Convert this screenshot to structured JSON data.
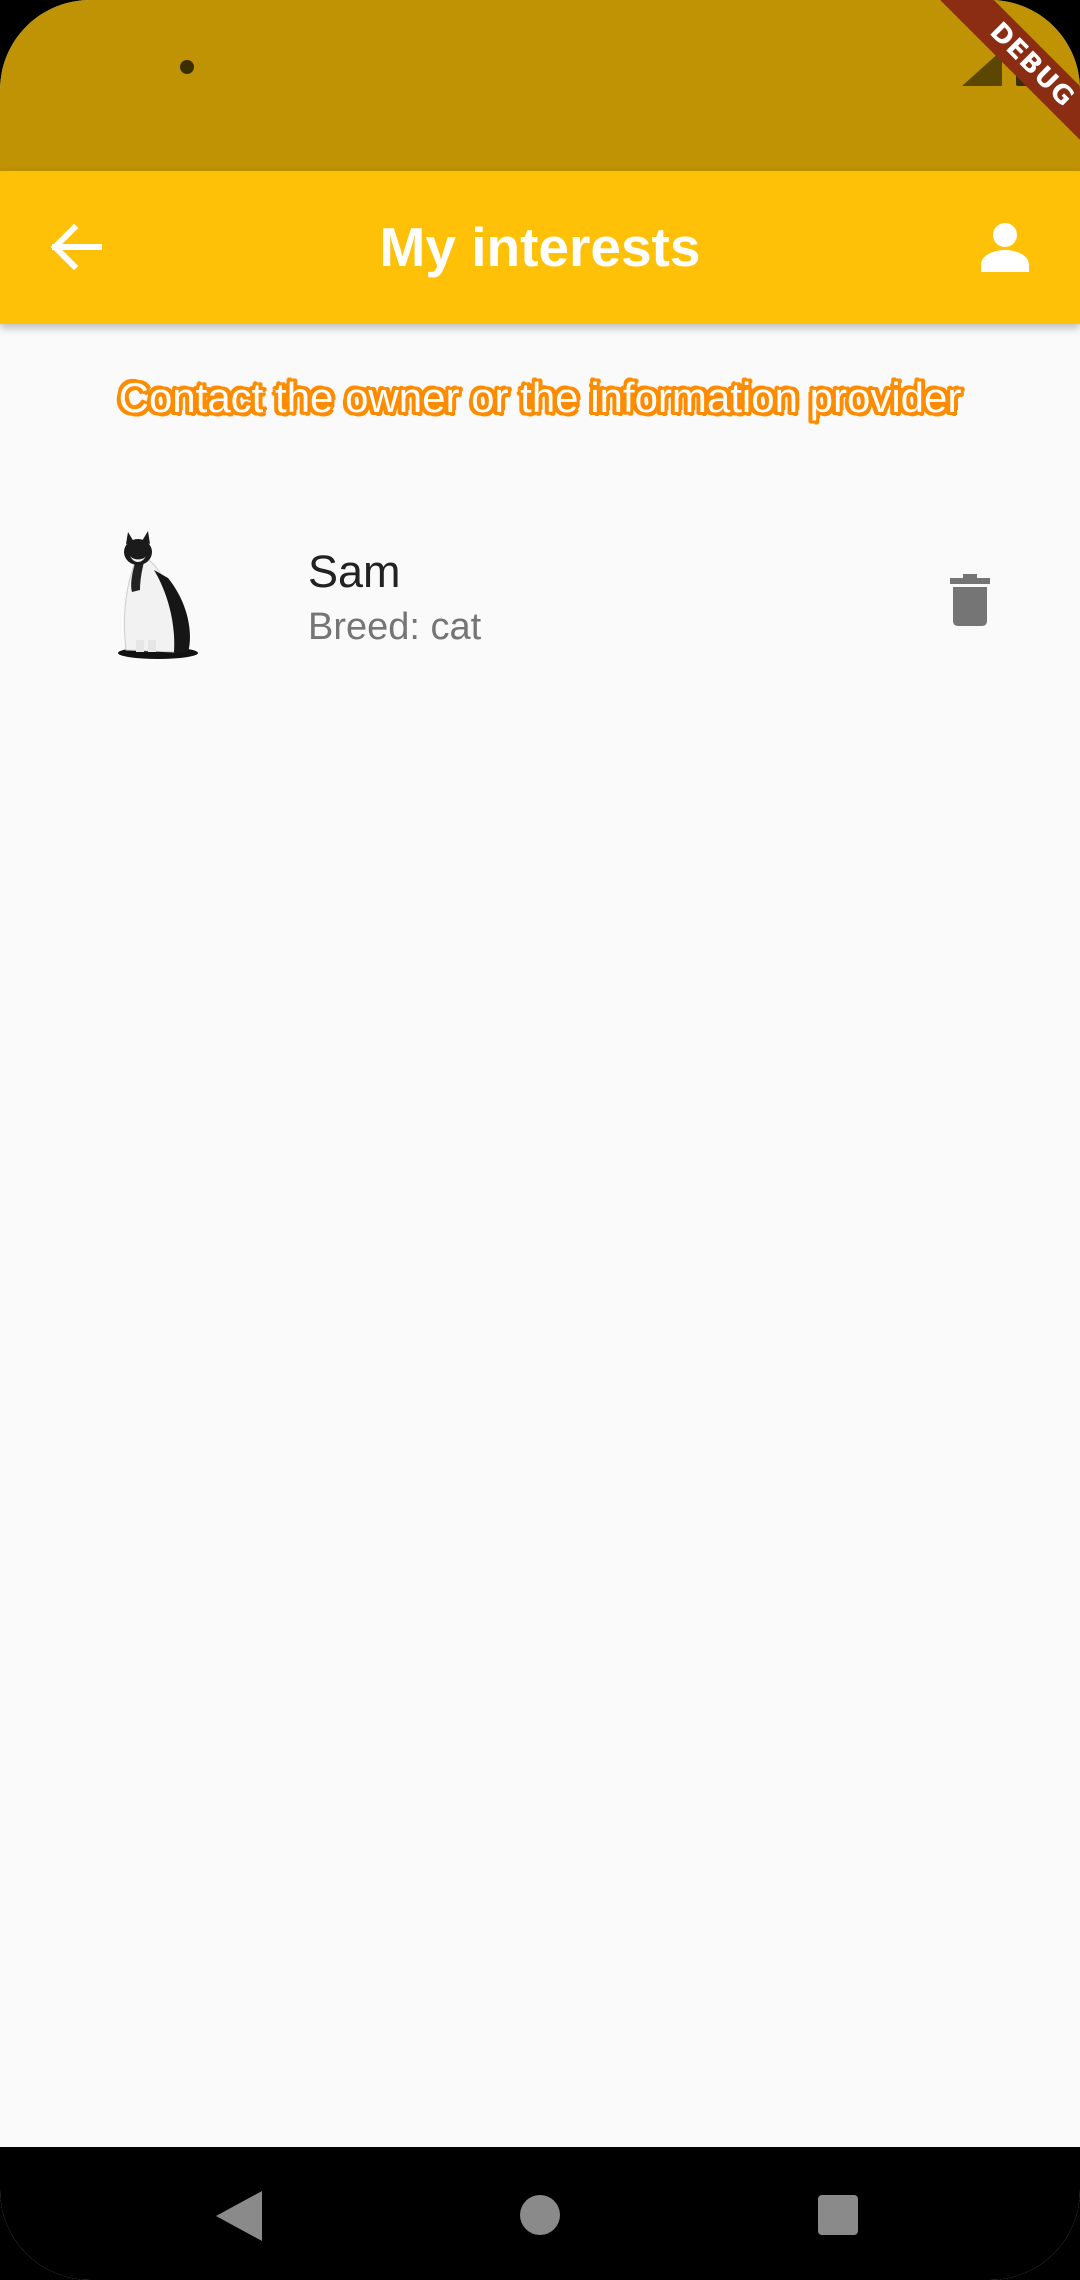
{
  "debug_banner": {
    "label": "DEBUG"
  },
  "app_bar": {
    "title": "My interests",
    "back_icon": "arrow-back-icon",
    "profile_icon": "person-icon",
    "background_color": "#ffc107"
  },
  "hint": {
    "text": "Contact the owner or the information provider",
    "outline_color": "#ff8c00"
  },
  "interests": [
    {
      "name": "Sam",
      "breed": "Breed: cat",
      "action_icon": "trash-icon"
    }
  ],
  "nav_bar": {
    "icons": [
      "back-triangle-icon",
      "home-circle-icon",
      "recents-square-icon"
    ]
  }
}
